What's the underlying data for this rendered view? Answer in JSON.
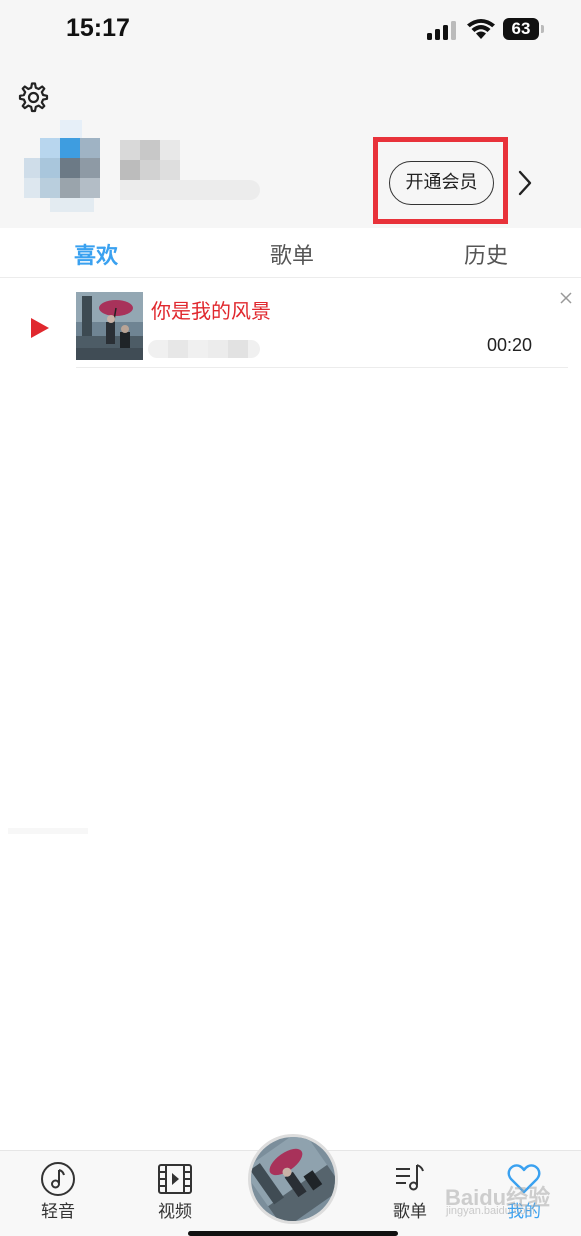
{
  "status_bar": {
    "time": "15:17",
    "battery": "63"
  },
  "profile": {
    "vip_button_label": "开通会员"
  },
  "tabs": [
    {
      "label": "喜欢",
      "active": true
    },
    {
      "label": "歌单",
      "active": false
    },
    {
      "label": "历史",
      "active": false
    }
  ],
  "favorites": [
    {
      "title": "你是我的风景",
      "duration": "00:20",
      "playing": true
    }
  ],
  "bottom_nav": [
    {
      "label": "轻音",
      "icon": "music-note-icon",
      "active": false
    },
    {
      "label": "视频",
      "icon": "film-icon",
      "active": false
    },
    {
      "label": "歌单",
      "icon": "playlist-icon",
      "active": false
    },
    {
      "label": "我的",
      "icon": "heart-icon",
      "active": true
    }
  ],
  "colors": {
    "accent": "#3aa1f0",
    "playing": "#e0282e",
    "highlight_box": "#e8323a"
  },
  "watermark": {
    "brand": "Baidu经验",
    "url": "jingyan.baidu.com"
  }
}
